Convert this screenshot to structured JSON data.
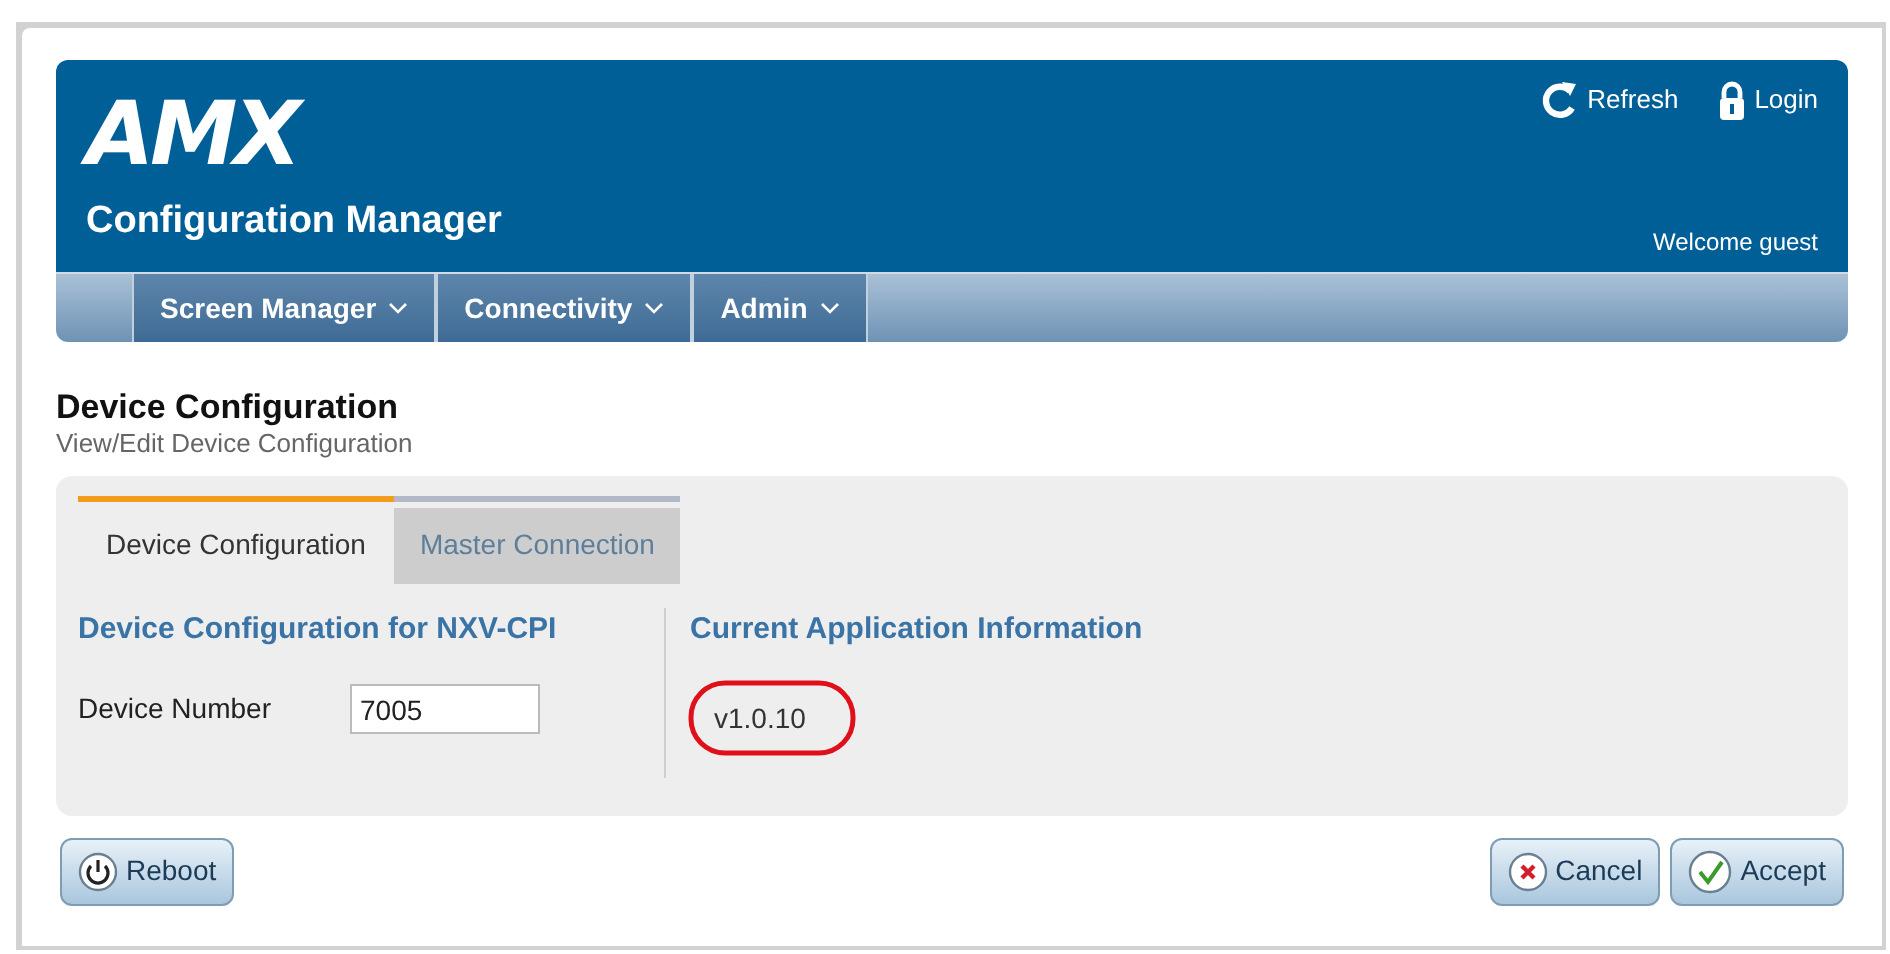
{
  "header": {
    "logo": "AMX",
    "title": "Configuration Manager",
    "actions": [
      {
        "kind": "refresh",
        "label": "Refresh"
      },
      {
        "kind": "login",
        "label": "Login"
      }
    ],
    "welcome": "Welcome guest"
  },
  "nav": {
    "items": [
      {
        "label": "Screen Manager"
      },
      {
        "label": "Connectivity"
      },
      {
        "label": "Admin"
      }
    ]
  },
  "page": {
    "title": "Device Configuration",
    "subtitle": "View/Edit Device Configuration"
  },
  "tabs": [
    {
      "label": "Device Configuration",
      "selected": true
    },
    {
      "label": "Master Connection",
      "selected": false
    }
  ],
  "left_section": {
    "heading": "Device Configuration for NXV-CPI",
    "field": {
      "label": "Device Number",
      "value": "7005"
    }
  },
  "right_section": {
    "heading": "Current Application Information",
    "version": "v1.0.10",
    "highlighted": true
  },
  "buttons": [
    {
      "kind": "reboot",
      "label": "Reboot"
    },
    {
      "kind": "cancel",
      "label": "Cancel"
    },
    {
      "kind": "accept",
      "label": "Accept"
    }
  ]
}
